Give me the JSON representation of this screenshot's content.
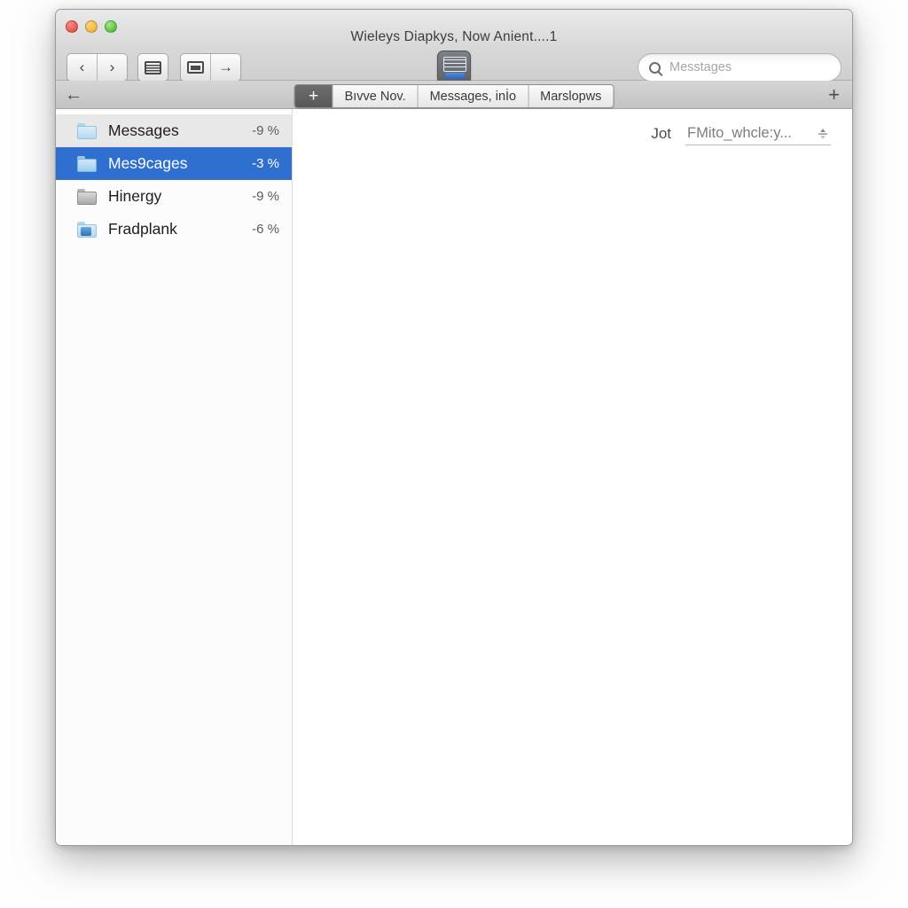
{
  "window": {
    "title": "Wieleys Diapkys, Now Anient....1",
    "traffic_lights": [
      "close-button",
      "minimize-button",
      "zoom-button"
    ]
  },
  "toolbar": {
    "back_label": "‹",
    "forward_label": "›",
    "snapshot_icon": "snapshot-icon",
    "caption_icon": "caption-icon",
    "share_label": "→",
    "center_icon": "presentation-icon",
    "search": {
      "placeholder": "Messtages",
      "value": "",
      "icon": "search-icon"
    }
  },
  "tabbar": {
    "back_label": "←",
    "add_tab_label": "+",
    "add_right_label": "+",
    "tabs": [
      {
        "label": "Bıvve Nov."
      },
      {
        "label": "Messages, inİo"
      },
      {
        "label": "Marslopws"
      }
    ]
  },
  "sidebar": {
    "items": [
      {
        "label": "Messages",
        "pct": "-9 %",
        "icon": "folder-icon",
        "state": "hovered"
      },
      {
        "label": "Mes9cages",
        "pct": "-3 %",
        "icon": "folder-icon",
        "state": "selected"
      },
      {
        "label": "Hinergy",
        "pct": "-9 %",
        "icon": "folder-gray-icon",
        "state": "normal"
      },
      {
        "label": "Fradplank",
        "pct": "-6 %",
        "icon": "folder-badge-icon",
        "state": "normal"
      }
    ]
  },
  "content": {
    "jot_label": "Jot",
    "jot_value": "FMito_whcle:y...",
    "stepper_icon": "stepper-icon"
  },
  "colors": {
    "selection_blue": "#2f6fd0",
    "titlebar_gray": "#d8d8d8",
    "tabbar_gray": "#c9c9c9"
  }
}
